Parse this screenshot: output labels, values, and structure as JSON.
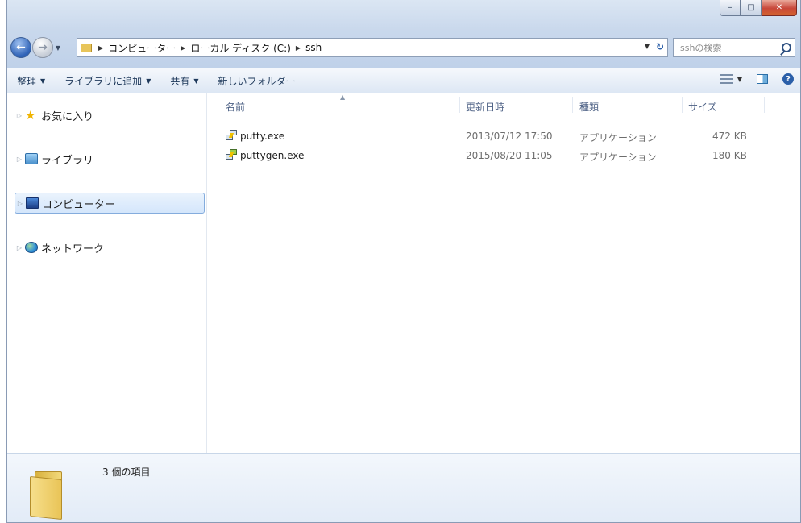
{
  "window": {
    "caption_buttons": {
      "minimize": "–",
      "maximize": "□",
      "close": "✕"
    }
  },
  "address": {
    "crumbs": [
      "コンピューター",
      "ローカル ディスク (C:)",
      "ssh"
    ]
  },
  "search": {
    "placeholder": "sshの検索"
  },
  "command_bar": {
    "items": [
      {
        "label": "整理",
        "has_dropdown": true
      },
      {
        "label": "ライブラリに追加",
        "has_dropdown": true
      },
      {
        "label": "共有",
        "has_dropdown": true
      },
      {
        "label": "新しいフォルダー",
        "has_dropdown": false
      }
    ]
  },
  "navigation": {
    "items": [
      {
        "label": "お気に入り",
        "icon": "star-icon",
        "selected": false
      },
      {
        "label": "ライブラリ",
        "icon": "library-icon",
        "selected": false
      },
      {
        "label": "コンピューター",
        "icon": "computer-icon",
        "selected": true
      },
      {
        "label": "ネットワーク",
        "icon": "network-icon",
        "selected": false
      }
    ]
  },
  "file_list": {
    "columns": {
      "name": "名前",
      "modified": "更新日時",
      "type": "種類",
      "size": "サイズ"
    },
    "rows": [
      {
        "name": "putty.exe",
        "modified": "2013/07/12 17:50",
        "type": "アプリケーション",
        "size": "472 KB",
        "icon": "putty-icon"
      },
      {
        "name": "puttygen.exe",
        "modified": "2015/08/20 11:05",
        "type": "アプリケーション",
        "size": "180 KB",
        "icon": "puttygen-icon"
      }
    ]
  },
  "details": {
    "item_count": "3 個の項目",
    "icon": "folder-icon"
  }
}
